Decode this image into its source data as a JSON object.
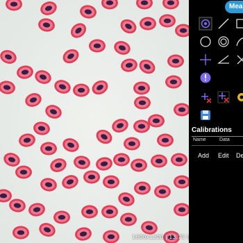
{
  "viewer": {
    "overlay_info": "1600x1200 | 13.79 fps"
  },
  "panel": {
    "measure_tab": "Measure",
    "tools": [
      {
        "icon": "circle-dot-icon"
      },
      {
        "icon": "line-icon"
      },
      {
        "icon": "rectangle-icon"
      },
      {
        "icon": "circle-icon"
      },
      {
        "icon": "double-circle-icon"
      },
      {
        "icon": "arc-icon"
      },
      {
        "icon": "crosshair-icon"
      },
      {
        "icon": "angle-icon"
      },
      {
        "icon": "cross-icon"
      },
      {
        "icon": "info-icon"
      },
      {
        "icon": "delete-one-icon"
      },
      {
        "icon": "delete-all-icon"
      },
      {
        "icon": "settings-icon"
      },
      {
        "icon": "export-icon"
      }
    ],
    "calibrations": {
      "title": "Calibrations",
      "col_name": "Name",
      "col_data": "Data",
      "add": "Add",
      "edit": "Edit",
      "delete": "Delete"
    }
  }
}
